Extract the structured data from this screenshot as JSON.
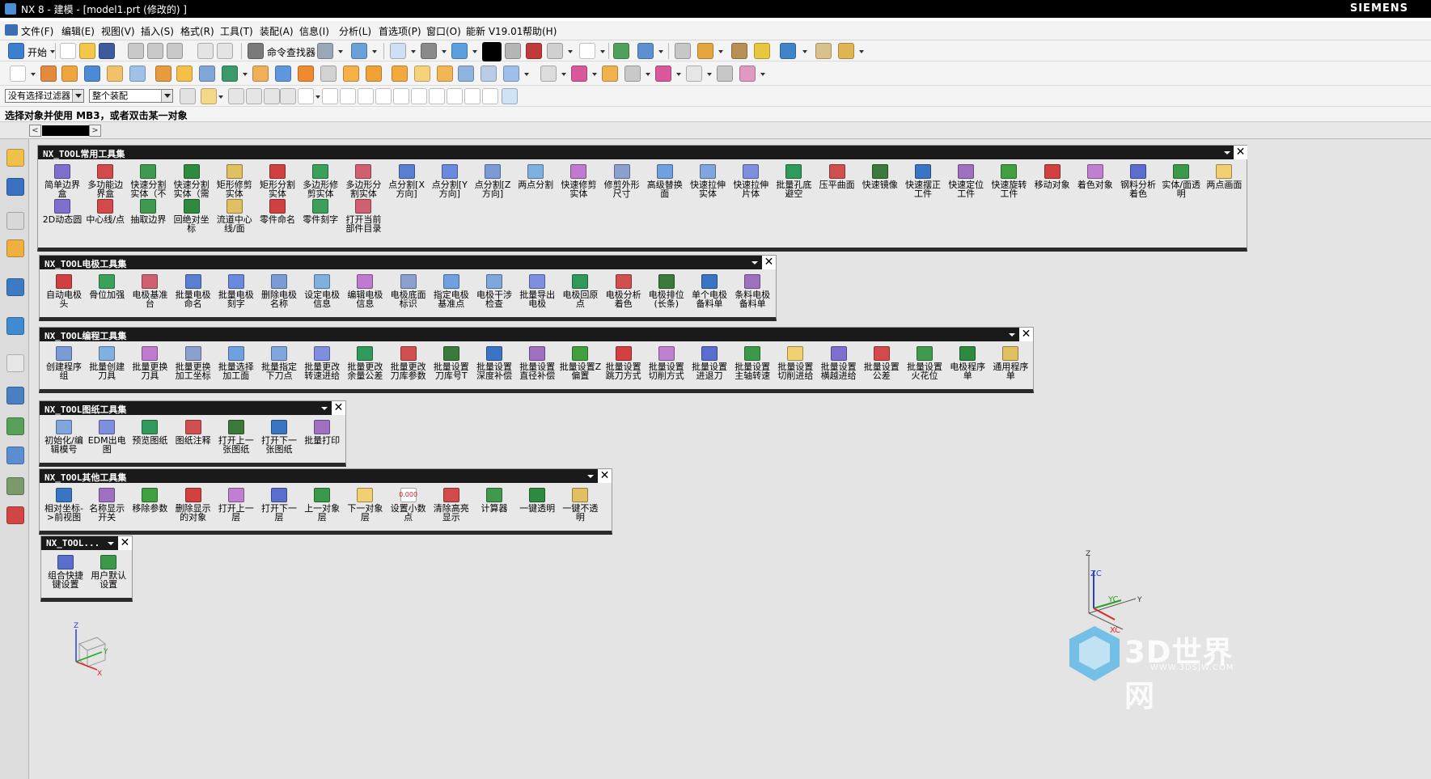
{
  "window": {
    "title": "NX 8 - 建模 - [model1.prt  (修改的) ]",
    "brand": "SIEMENS"
  },
  "menu": [
    "文件(F)",
    "编辑(E)",
    "视图(V)",
    "插入(S)",
    "格式(R)",
    "工具(T)",
    "装配(A)",
    "信息(I)",
    "分析(L)",
    "首选项(P)",
    "窗口(O)",
    "能新 V19.01",
    "帮助(H)"
  ],
  "toolbar": {
    "start_label": "开始",
    "command_finder_label": "命令查找器"
  },
  "selection": {
    "filter_value": "没有选择过滤器",
    "scope_value": "整个装配"
  },
  "status": {
    "prompt": "选择对象并使用 MB3，或者双击某一对象"
  },
  "panels": [
    {
      "title": "NX_TOOL常用工具集",
      "tools": [
        "简单边界盒",
        "多功能边界盒",
        "快速分割实体（不",
        "快速分割实体（需",
        "矩形修剪实体",
        "矩形分割实体",
        "多边形修剪实体",
        "多边形分割实体",
        "点分割[X方向]",
        "点分割[Y方向]",
        "点分割[Z方向]",
        "两点分割",
        "快速修剪实体",
        "修剪外形尺寸",
        "高级替换面",
        "快速拉伸实体",
        "快速拉伸片体",
        "批量孔底避空",
        "压平曲面",
        "快速镜像",
        "快速摆正工件",
        "快速定位工件",
        "快速旋转工件",
        "移动对象",
        "着色对象",
        "钢料分析着色",
        "实体/面透明",
        "两点画面",
        "2D动态圆",
        "中心线/点",
        "抽取边界",
        "回绝对坐标",
        "流道中心线/面",
        "零件命名",
        "零件刻字",
        "打开当前部件目录"
      ]
    },
    {
      "title": "NX_TOOL电极工具集",
      "tools": [
        "自动电极头",
        "骨位加强",
        "电极基准台",
        "批量电极命名",
        "批量电极刻字",
        "删除电极名称",
        "设定电极信息",
        "编辑电极信息",
        "电极底面标识",
        "指定电极基准点",
        "电极干涉检查",
        "批量导出电极",
        "电极回原点",
        "电极分析着色",
        "电极排位(长条)",
        "单个电极备料单",
        "条料电极备料单"
      ]
    },
    {
      "title": "NX_TOOL编程工具集",
      "tools": [
        "创建程序组",
        "批量创建刀具",
        "批量更换刀具",
        "批量更换加工坐标",
        "批量选择加工面",
        "批量指定下刀点",
        "批量更改转速进给",
        "批量更改余量公差",
        "批量更改刀库参数",
        "批量设置刀库号T",
        "批量设置深度补偿",
        "批量设置直径补偿",
        "批量设置Z偏置",
        "批量设置跳刀方式",
        "批量设置切削方式",
        "批量设置进退刀",
        "批量设置主轴转速",
        "批量设置切削进给",
        "批量设置横越进给",
        "批量设置公差",
        "批量设置火花位",
        "电极程序单",
        "通用程序单"
      ]
    },
    {
      "title": "NX_TOOL图纸工具集",
      "tools": [
        "初始化/编辑模号",
        "EDM出电图",
        "预览图纸",
        "图纸注释",
        "打开上一张图纸",
        "打开下一张图纸",
        "批量打印"
      ]
    },
    {
      "title": "NX_TOOL其他工具集",
      "tools": [
        "相对坐标->前视图",
        "名称显示开关",
        "移除参数",
        "删除显示的对象",
        "打开上一层",
        "打开下一层",
        "上一对象层",
        "下一对象层",
        "设置小数点",
        "清除高亮显示",
        "计算器",
        "一键透明",
        "一键不透明"
      ],
      "extra": "0.000"
    },
    {
      "title": "NX_TOOL...",
      "tools": [
        "组合快捷键设置",
        "用户默认设置"
      ]
    }
  ],
  "triad": {
    "zc": "ZC",
    "yc": "YC",
    "xc": "XC",
    "x": "X",
    "y": "Y",
    "z": "Z"
  },
  "watermark": {
    "text": "3D世界网",
    "url": "WWW.3DSJW.COM"
  },
  "colors": {
    "background": "#e4e4e4",
    "panel_header": "#1a1a1a",
    "titlebar": "#000000",
    "accent_blue": "#4a8ed6"
  }
}
